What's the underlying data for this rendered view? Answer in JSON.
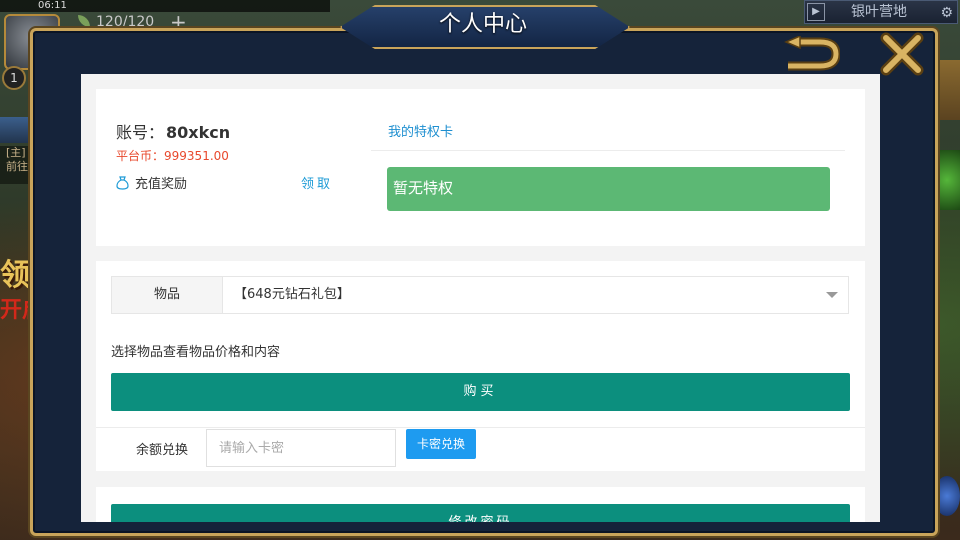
{
  "status_bar": {
    "time": "06:11"
  },
  "hud": {
    "level": "1",
    "stamina": "120/120",
    "plus": "+",
    "location": "银叶营地",
    "side_tag_1": "[主]",
    "side_tag_2": "前往",
    "side_big_text": "领",
    "side_red_text": "开启"
  },
  "modal": {
    "title": "个人中心"
  },
  "account": {
    "account_label": "账号：",
    "account_value": "80xkcn",
    "coin_label": "平台币：",
    "coin_value": "999351.00",
    "recharge_label": "充值奖励",
    "claim_label": "领取"
  },
  "privilege": {
    "title": "我的特权卡",
    "status": "暂无特权"
  },
  "shop": {
    "item_label": "物品",
    "item_selected": "【648元钻石礼包】",
    "hint": "选择物品查看物品价格和内容",
    "buy_label": "购买"
  },
  "redeem": {
    "label": "余额兑换",
    "placeholder": "请输入卡密",
    "button_label": "卡密兑换"
  },
  "password": {
    "button_label": "修改密码"
  },
  "colors": {
    "accent_teal": "#0c8f7e",
    "privilege_green": "#5cb874",
    "link_blue": "#1e9bd6",
    "coin_red": "#e8492d",
    "frame_gold": "#c9a45a"
  }
}
